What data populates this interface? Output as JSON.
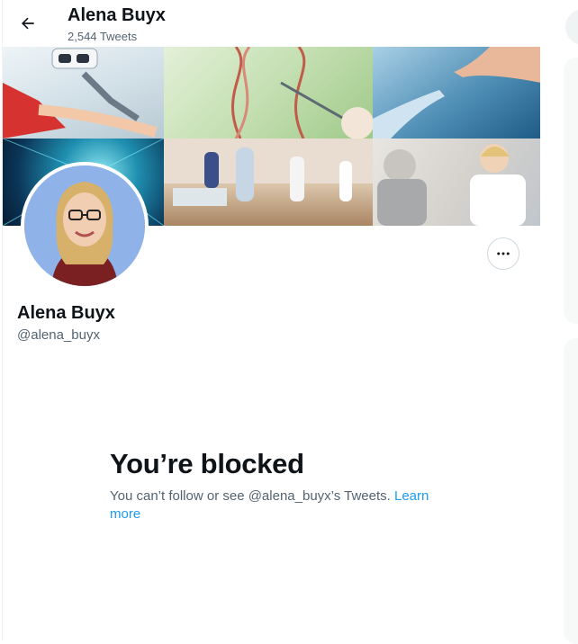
{
  "header": {
    "name": "Alena Buyx",
    "tweet_count": "2,544 Tweets"
  },
  "profile": {
    "name": "Alena Buyx",
    "handle": "@alena_buyx"
  },
  "blocked": {
    "title": "You’re blocked",
    "message": "You can’t follow or see @alena_buyx’s Tweets. ",
    "link": "Learn more"
  },
  "icons": {
    "back": "arrow-left-icon",
    "more": "ellipsis-icon"
  },
  "colors": {
    "link": "#1d9bf0",
    "secondary_text": "#536471",
    "primary_text": "#0f1419"
  }
}
